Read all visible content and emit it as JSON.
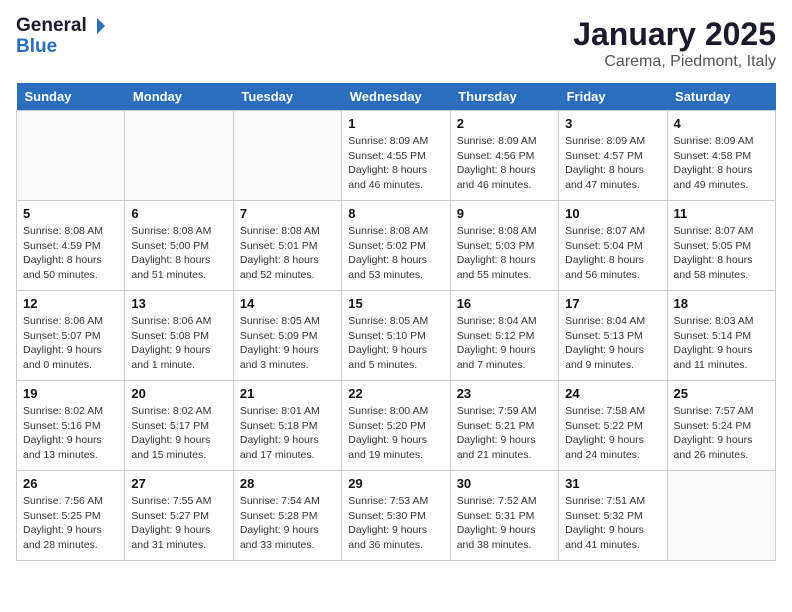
{
  "header": {
    "logo_general": "General",
    "logo_blue": "Blue",
    "title": "January 2025",
    "subtitle": "Carema, Piedmont, Italy"
  },
  "days": [
    "Sunday",
    "Monday",
    "Tuesday",
    "Wednesday",
    "Thursday",
    "Friday",
    "Saturday"
  ],
  "weeks": [
    [
      {
        "date": "",
        "info": ""
      },
      {
        "date": "",
        "info": ""
      },
      {
        "date": "",
        "info": ""
      },
      {
        "date": "1",
        "info": "Sunrise: 8:09 AM\nSunset: 4:55 PM\nDaylight: 8 hours\nand 46 minutes."
      },
      {
        "date": "2",
        "info": "Sunrise: 8:09 AM\nSunset: 4:56 PM\nDaylight: 8 hours\nand 46 minutes."
      },
      {
        "date": "3",
        "info": "Sunrise: 8:09 AM\nSunset: 4:57 PM\nDaylight: 8 hours\nand 47 minutes."
      },
      {
        "date": "4",
        "info": "Sunrise: 8:09 AM\nSunset: 4:58 PM\nDaylight: 8 hours\nand 49 minutes."
      }
    ],
    [
      {
        "date": "5",
        "info": "Sunrise: 8:08 AM\nSunset: 4:59 PM\nDaylight: 8 hours\nand 50 minutes."
      },
      {
        "date": "6",
        "info": "Sunrise: 8:08 AM\nSunset: 5:00 PM\nDaylight: 8 hours\nand 51 minutes."
      },
      {
        "date": "7",
        "info": "Sunrise: 8:08 AM\nSunset: 5:01 PM\nDaylight: 8 hours\nand 52 minutes."
      },
      {
        "date": "8",
        "info": "Sunrise: 8:08 AM\nSunset: 5:02 PM\nDaylight: 8 hours\nand 53 minutes."
      },
      {
        "date": "9",
        "info": "Sunrise: 8:08 AM\nSunset: 5:03 PM\nDaylight: 8 hours\nand 55 minutes."
      },
      {
        "date": "10",
        "info": "Sunrise: 8:07 AM\nSunset: 5:04 PM\nDaylight: 8 hours\nand 56 minutes."
      },
      {
        "date": "11",
        "info": "Sunrise: 8:07 AM\nSunset: 5:05 PM\nDaylight: 8 hours\nand 58 minutes."
      }
    ],
    [
      {
        "date": "12",
        "info": "Sunrise: 8:06 AM\nSunset: 5:07 PM\nDaylight: 9 hours\nand 0 minutes."
      },
      {
        "date": "13",
        "info": "Sunrise: 8:06 AM\nSunset: 5:08 PM\nDaylight: 9 hours\nand 1 minute."
      },
      {
        "date": "14",
        "info": "Sunrise: 8:05 AM\nSunset: 5:09 PM\nDaylight: 9 hours\nand 3 minutes."
      },
      {
        "date": "15",
        "info": "Sunrise: 8:05 AM\nSunset: 5:10 PM\nDaylight: 9 hours\nand 5 minutes."
      },
      {
        "date": "16",
        "info": "Sunrise: 8:04 AM\nSunset: 5:12 PM\nDaylight: 9 hours\nand 7 minutes."
      },
      {
        "date": "17",
        "info": "Sunrise: 8:04 AM\nSunset: 5:13 PM\nDaylight: 9 hours\nand 9 minutes."
      },
      {
        "date": "18",
        "info": "Sunrise: 8:03 AM\nSunset: 5:14 PM\nDaylight: 9 hours\nand 11 minutes."
      }
    ],
    [
      {
        "date": "19",
        "info": "Sunrise: 8:02 AM\nSunset: 5:16 PM\nDaylight: 9 hours\nand 13 minutes."
      },
      {
        "date": "20",
        "info": "Sunrise: 8:02 AM\nSunset: 5:17 PM\nDaylight: 9 hours\nand 15 minutes."
      },
      {
        "date": "21",
        "info": "Sunrise: 8:01 AM\nSunset: 5:18 PM\nDaylight: 9 hours\nand 17 minutes."
      },
      {
        "date": "22",
        "info": "Sunrise: 8:00 AM\nSunset: 5:20 PM\nDaylight: 9 hours\nand 19 minutes."
      },
      {
        "date": "23",
        "info": "Sunrise: 7:59 AM\nSunset: 5:21 PM\nDaylight: 9 hours\nand 21 minutes."
      },
      {
        "date": "24",
        "info": "Sunrise: 7:58 AM\nSunset: 5:22 PM\nDaylight: 9 hours\nand 24 minutes."
      },
      {
        "date": "25",
        "info": "Sunrise: 7:57 AM\nSunset: 5:24 PM\nDaylight: 9 hours\nand 26 minutes."
      }
    ],
    [
      {
        "date": "26",
        "info": "Sunrise: 7:56 AM\nSunset: 5:25 PM\nDaylight: 9 hours\nand 28 minutes."
      },
      {
        "date": "27",
        "info": "Sunrise: 7:55 AM\nSunset: 5:27 PM\nDaylight: 9 hours\nand 31 minutes."
      },
      {
        "date": "28",
        "info": "Sunrise: 7:54 AM\nSunset: 5:28 PM\nDaylight: 9 hours\nand 33 minutes."
      },
      {
        "date": "29",
        "info": "Sunrise: 7:53 AM\nSunset: 5:30 PM\nDaylight: 9 hours\nand 36 minutes."
      },
      {
        "date": "30",
        "info": "Sunrise: 7:52 AM\nSunset: 5:31 PM\nDaylight: 9 hours\nand 38 minutes."
      },
      {
        "date": "31",
        "info": "Sunrise: 7:51 AM\nSunset: 5:32 PM\nDaylight: 9 hours\nand 41 minutes."
      },
      {
        "date": "",
        "info": ""
      }
    ]
  ]
}
